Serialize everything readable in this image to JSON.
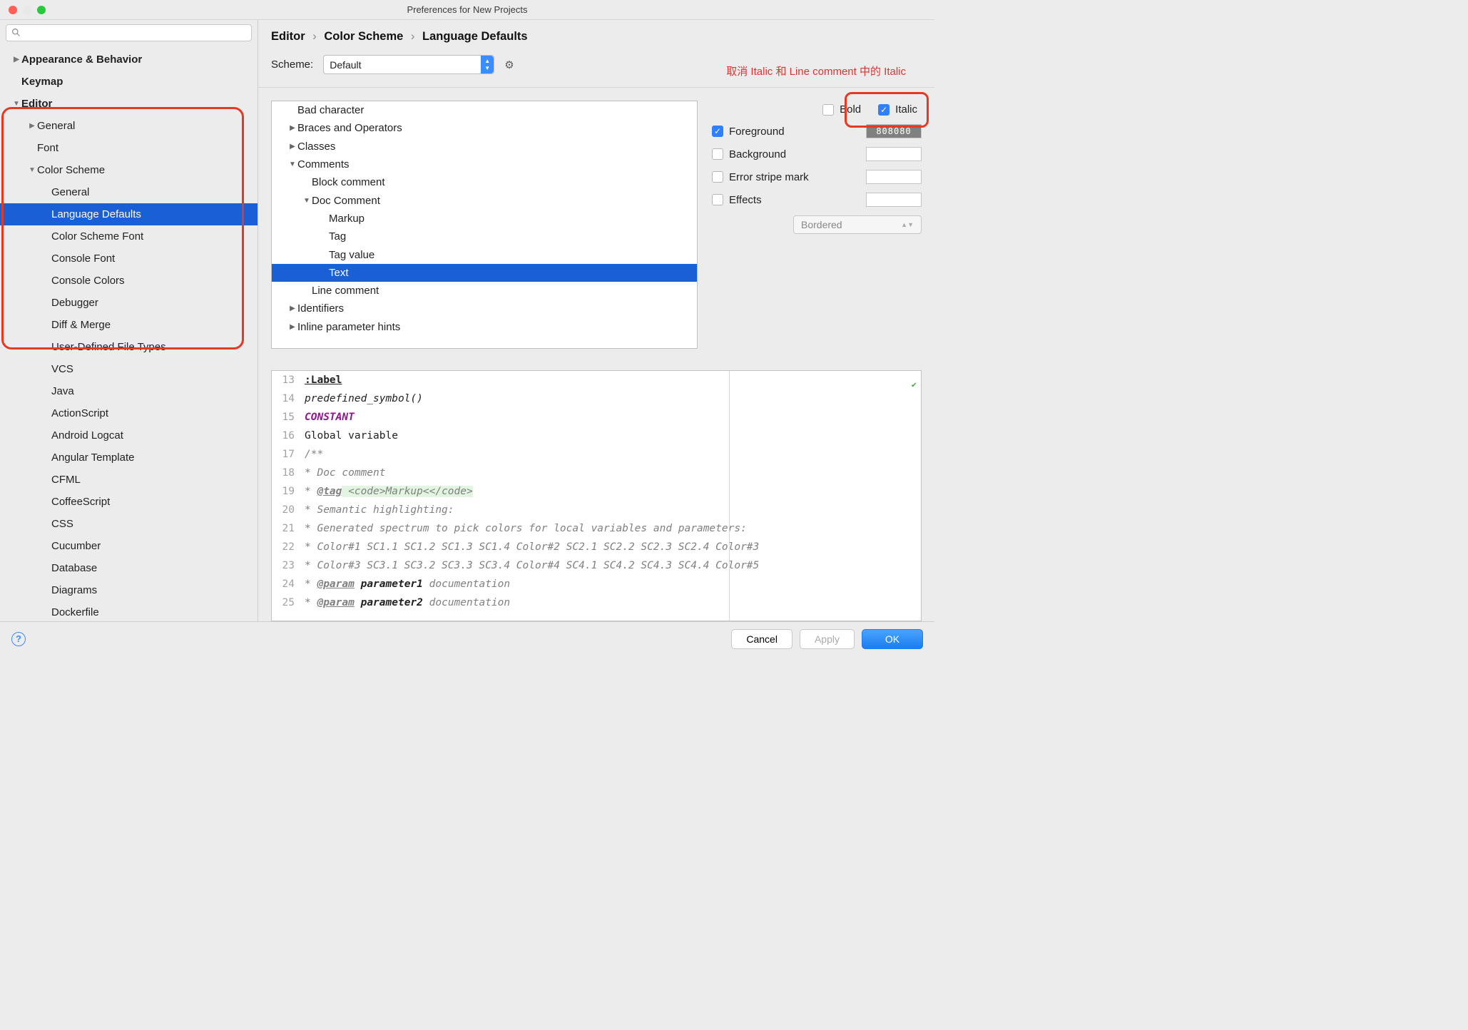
{
  "window": {
    "title": "Preferences for New Projects"
  },
  "search": {
    "placeholder": ""
  },
  "sidebar": [
    {
      "label": "Appearance & Behavior",
      "depth": 0,
      "bold": true,
      "arrow": "▶"
    },
    {
      "label": "Keymap",
      "depth": 0,
      "bold": true,
      "arrow": ""
    },
    {
      "label": "Editor",
      "depth": 0,
      "bold": true,
      "arrow": "▼"
    },
    {
      "label": "General",
      "depth": 1,
      "arrow": "▶"
    },
    {
      "label": "Font",
      "depth": 1,
      "arrow": ""
    },
    {
      "label": "Color Scheme",
      "depth": 1,
      "arrow": "▼"
    },
    {
      "label": "General",
      "depth": 2,
      "arrow": ""
    },
    {
      "label": "Language Defaults",
      "depth": 2,
      "arrow": "",
      "selected": true
    },
    {
      "label": "Color Scheme Font",
      "depth": 2,
      "arrow": ""
    },
    {
      "label": "Console Font",
      "depth": 2,
      "arrow": ""
    },
    {
      "label": "Console Colors",
      "depth": 2,
      "arrow": ""
    },
    {
      "label": "Debugger",
      "depth": 2,
      "arrow": ""
    },
    {
      "label": "Diff & Merge",
      "depth": 2,
      "arrow": ""
    },
    {
      "label": "User-Defined File Types",
      "depth": 2,
      "arrow": ""
    },
    {
      "label": "VCS",
      "depth": 2,
      "arrow": ""
    },
    {
      "label": "Java",
      "depth": 2,
      "arrow": ""
    },
    {
      "label": "ActionScript",
      "depth": 2,
      "arrow": ""
    },
    {
      "label": "Android Logcat",
      "depth": 2,
      "arrow": ""
    },
    {
      "label": "Angular Template",
      "depth": 2,
      "arrow": ""
    },
    {
      "label": "CFML",
      "depth": 2,
      "arrow": ""
    },
    {
      "label": "CoffeeScript",
      "depth": 2,
      "arrow": ""
    },
    {
      "label": "CSS",
      "depth": 2,
      "arrow": ""
    },
    {
      "label": "Cucumber",
      "depth": 2,
      "arrow": ""
    },
    {
      "label": "Database",
      "depth": 2,
      "arrow": ""
    },
    {
      "label": "Diagrams",
      "depth": 2,
      "arrow": ""
    },
    {
      "label": "Dockerfile",
      "depth": 2,
      "arrow": ""
    }
  ],
  "breadcrumbs": [
    "Editor",
    "Color Scheme",
    "Language Defaults"
  ],
  "scheme": {
    "label": "Scheme:",
    "value": "Default"
  },
  "annotation": "取消 Italic 和 Line comment 中的 Italic",
  "attrs": [
    {
      "label": "Bad character",
      "depth": 0,
      "arrow": ""
    },
    {
      "label": "Braces and Operators",
      "depth": 0,
      "arrow": "▶"
    },
    {
      "label": "Classes",
      "depth": 0,
      "arrow": "▶"
    },
    {
      "label": "Comments",
      "depth": 0,
      "arrow": "▼"
    },
    {
      "label": "Block comment",
      "depth": 1,
      "arrow": ""
    },
    {
      "label": "Doc Comment",
      "depth": 1,
      "arrow": "▼"
    },
    {
      "label": "Markup",
      "depth": 2,
      "arrow": ""
    },
    {
      "label": "Tag",
      "depth": 2,
      "arrow": ""
    },
    {
      "label": "Tag value",
      "depth": 2,
      "arrow": ""
    },
    {
      "label": "Text",
      "depth": 2,
      "arrow": "",
      "selected": true
    },
    {
      "label": "Line comment",
      "depth": 1,
      "arrow": ""
    },
    {
      "label": "Identifiers",
      "depth": 0,
      "arrow": "▶"
    },
    {
      "label": "Inline parameter hints",
      "depth": 0,
      "arrow": "▶"
    }
  ],
  "style": {
    "bold": {
      "label": "Bold",
      "on": false
    },
    "italic": {
      "label": "Italic",
      "on": true
    },
    "foreground": {
      "label": "Foreground",
      "on": true,
      "value": "808080"
    },
    "background": {
      "label": "Background",
      "on": false
    },
    "errorstripe": {
      "label": "Error stripe mark",
      "on": false
    },
    "effects": {
      "label": "Effects",
      "on": false
    },
    "effectType": "Bordered"
  },
  "preview": {
    "start": 13,
    "lines": [
      {
        "t": "label",
        "txt": ":Label"
      },
      {
        "t": "pd",
        "txt": "predefined_symbol()"
      },
      {
        "t": "const",
        "txt": "CONSTANT"
      },
      {
        "t": "plain",
        "txt": "Global variable"
      },
      {
        "t": "cmt",
        "txt": "/**"
      },
      {
        "t": "cmt",
        "txt": " * Doc comment"
      },
      {
        "t": "tagline",
        "prefix": " * ",
        "tag": "@tag",
        "mk": " <code>Markup<</code>"
      },
      {
        "t": "cmt",
        "txt": " * Semantic highlighting:"
      },
      {
        "t": "cmt",
        "txt": " * Generated spectrum to pick colors for local variables and parameters:"
      },
      {
        "t": "cmt",
        "txt": " *  Color#1 SC1.1 SC1.2 SC1.3 SC1.4 Color#2 SC2.1 SC2.2 SC2.3 SC2.4 Color#3"
      },
      {
        "t": "cmt",
        "txt": " *  Color#3 SC3.1 SC3.2 SC3.3 SC3.4 Color#4 SC4.1 SC4.2 SC4.3 SC4.4 Color#5"
      },
      {
        "t": "paramline",
        "prefix": " * ",
        "tag": "@param",
        "param": "parameter1",
        "rest": " documentation"
      },
      {
        "t": "paramline",
        "prefix": " * ",
        "tag": "@param",
        "param": "parameter2",
        "rest": " documentation"
      }
    ]
  },
  "footer": {
    "cancel": "Cancel",
    "apply": "Apply",
    "ok": "OK"
  }
}
